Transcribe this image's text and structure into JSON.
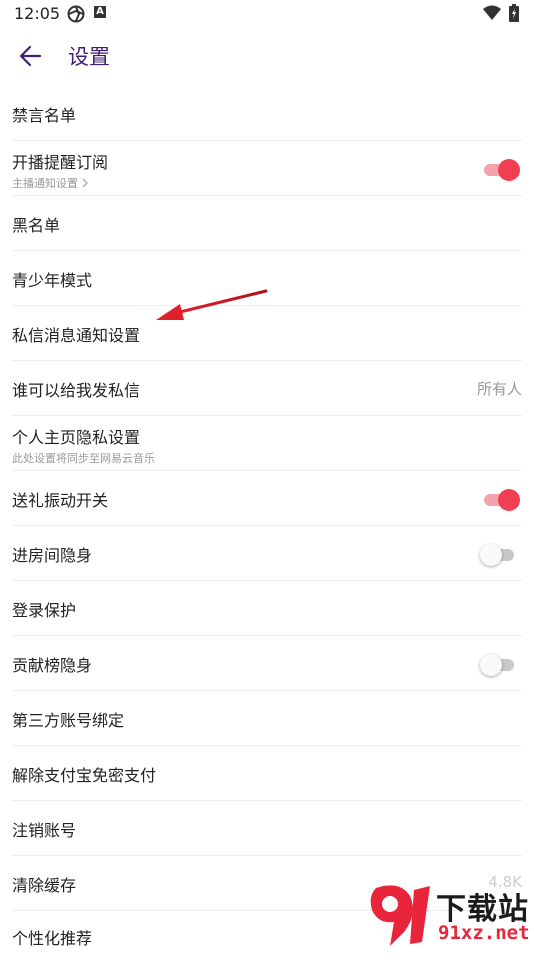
{
  "status_bar": {
    "time": "12:05",
    "icon_badge_letter": "A"
  },
  "header": {
    "title": "设置"
  },
  "rows": [
    {
      "label": "禁言名单"
    },
    {
      "label": "开播提醒订阅",
      "sub": "主播通知设置",
      "toggle": "on"
    },
    {
      "label": "黑名单"
    },
    {
      "label": "青少年模式"
    },
    {
      "label": "私信消息通知设置"
    },
    {
      "label": "谁可以给我发私信",
      "value": "所有人"
    },
    {
      "label": "个人主页隐私设置",
      "sub": "此处设置将同步至网易云音乐"
    },
    {
      "label": "送礼振动开关",
      "toggle": "on"
    },
    {
      "label": "进房间隐身",
      "toggle": "off"
    },
    {
      "label": "登录保护"
    },
    {
      "label": "贡献榜隐身",
      "toggle": "off"
    },
    {
      "label": "第三方账号绑定"
    },
    {
      "label": "解除支付宝免密支付"
    },
    {
      "label": "注销账号"
    },
    {
      "label": "清除缓存",
      "value": "4.8K"
    },
    {
      "label": "个性化推荐"
    }
  ],
  "watermark": {
    "title": "下载站",
    "url": "91xz.net"
  },
  "colors": {
    "accent_purple": "#3f1f75",
    "toggle_on": "#f03e52",
    "annotation_arrow": "#e0202a"
  }
}
